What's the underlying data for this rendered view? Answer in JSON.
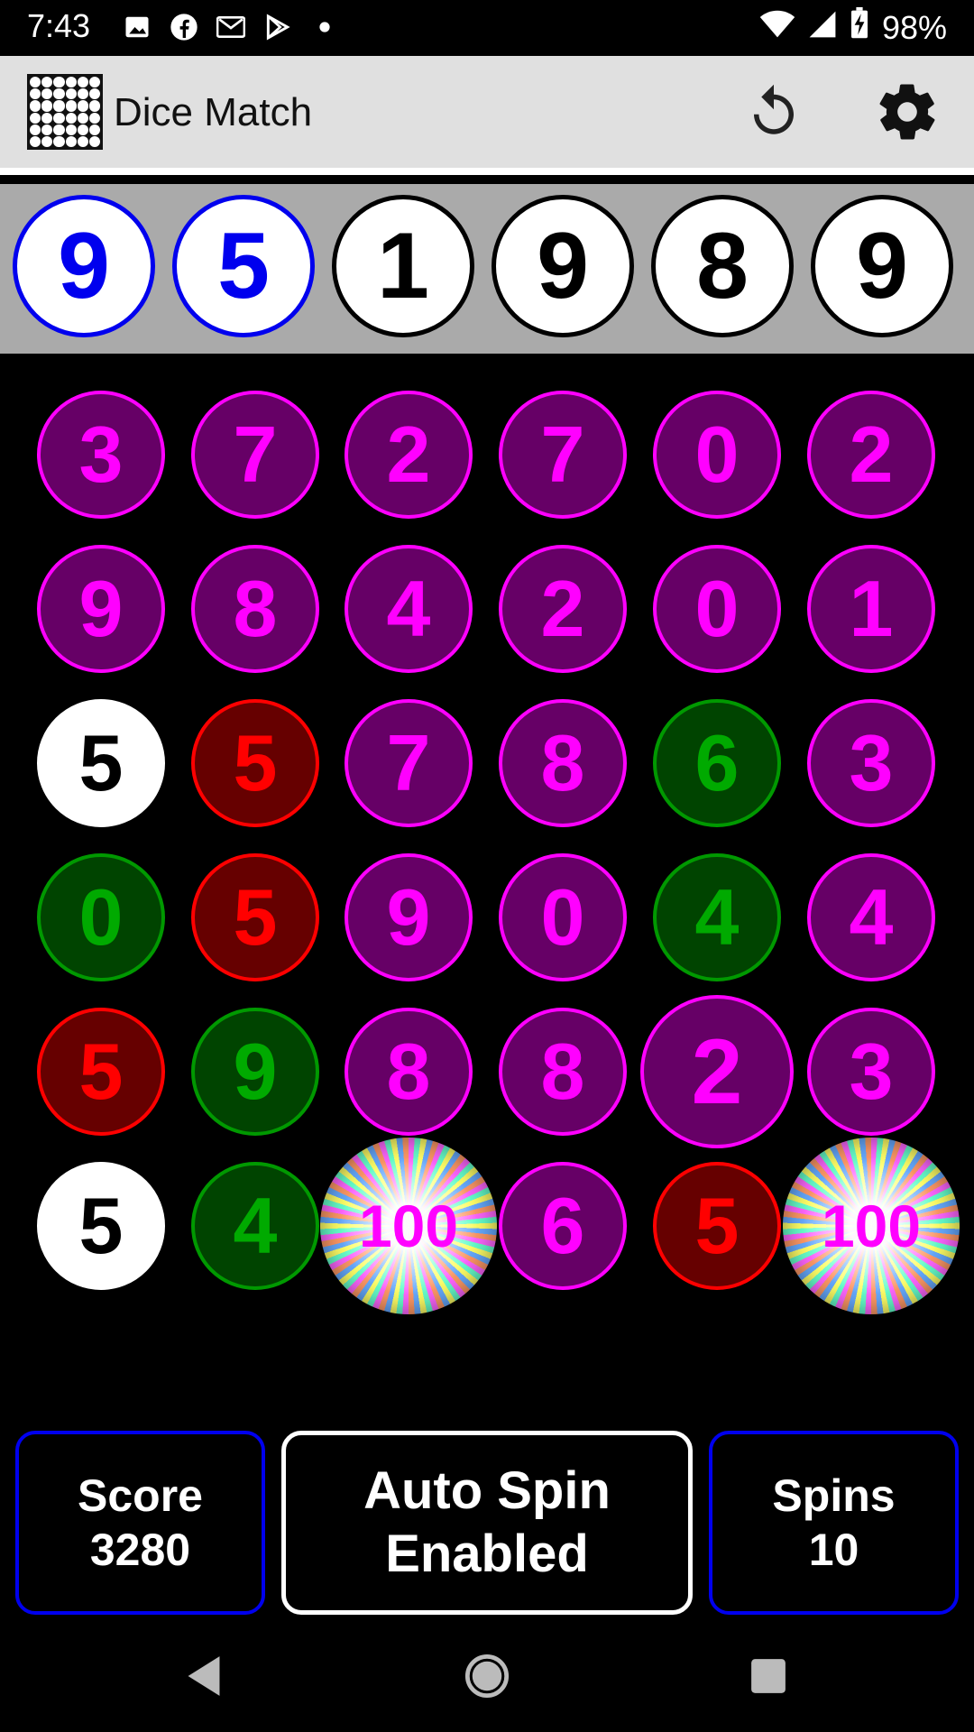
{
  "status_bar": {
    "time": "7:43",
    "battery": "98%",
    "left_icons": [
      "image-icon",
      "facebook-icon",
      "gmail-icon",
      "play-store-icon",
      "dot-icon"
    ],
    "right_icons": [
      "wifi-icon",
      "signal-icon",
      "battery-charging-icon"
    ]
  },
  "app_bar": {
    "title": "Dice Match",
    "actions": [
      "reset-icon",
      "settings-icon"
    ]
  },
  "targets": [
    {
      "value": "9",
      "state": "matched"
    },
    {
      "value": "5",
      "state": "matched"
    },
    {
      "value": "1",
      "state": "unmatched"
    },
    {
      "value": "9",
      "state": "unmatched"
    },
    {
      "value": "8",
      "state": "unmatched"
    },
    {
      "value": "9",
      "state": "unmatched"
    }
  ],
  "grid": [
    [
      {
        "v": "3",
        "c": "purple"
      },
      {
        "v": "7",
        "c": "purple"
      },
      {
        "v": "2",
        "c": "purple"
      },
      {
        "v": "7",
        "c": "purple"
      },
      {
        "v": "0",
        "c": "purple"
      },
      {
        "v": "2",
        "c": "purple"
      }
    ],
    [
      {
        "v": "9",
        "c": "purple"
      },
      {
        "v": "8",
        "c": "purple"
      },
      {
        "v": "4",
        "c": "purple"
      },
      {
        "v": "2",
        "c": "purple"
      },
      {
        "v": "0",
        "c": "purple"
      },
      {
        "v": "1",
        "c": "purple"
      }
    ],
    [
      {
        "v": "5",
        "c": "white"
      },
      {
        "v": "5",
        "c": "red"
      },
      {
        "v": "7",
        "c": "purple"
      },
      {
        "v": "8",
        "c": "purple"
      },
      {
        "v": "6",
        "c": "green"
      },
      {
        "v": "3",
        "c": "purple"
      }
    ],
    [
      {
        "v": "0",
        "c": "green"
      },
      {
        "v": "5",
        "c": "red"
      },
      {
        "v": "9",
        "c": "purple"
      },
      {
        "v": "0",
        "c": "purple"
      },
      {
        "v": "4",
        "c": "green"
      },
      {
        "v": "4",
        "c": "purple"
      }
    ],
    [
      {
        "v": "5",
        "c": "red"
      },
      {
        "v": "9",
        "c": "green"
      },
      {
        "v": "8",
        "c": "purple"
      },
      {
        "v": "8",
        "c": "purple"
      },
      {
        "v": "2",
        "c": "purple big"
      },
      {
        "v": "3",
        "c": "purple"
      }
    ],
    [
      {
        "v": "5",
        "c": "white"
      },
      {
        "v": "4",
        "c": "green"
      },
      {
        "v": "100",
        "c": "bonus"
      },
      {
        "v": "6",
        "c": "purple"
      },
      {
        "v": "5",
        "c": "red"
      },
      {
        "v": "100",
        "c": "bonus"
      }
    ]
  ],
  "bottom": {
    "score_label": "Score",
    "score_value": "3280",
    "auto_spin_line1": "Auto Spin",
    "auto_spin_line2": "Enabled",
    "spins_label": "Spins",
    "spins_value": "10"
  },
  "colors": {
    "purple_fill": "#660066",
    "purple_ring": "#ff00ff",
    "red_fill": "#660000",
    "red_ring": "#ff0000",
    "green_fill": "#004400",
    "green_ring": "#009900",
    "matched_blue": "#0000ee"
  }
}
